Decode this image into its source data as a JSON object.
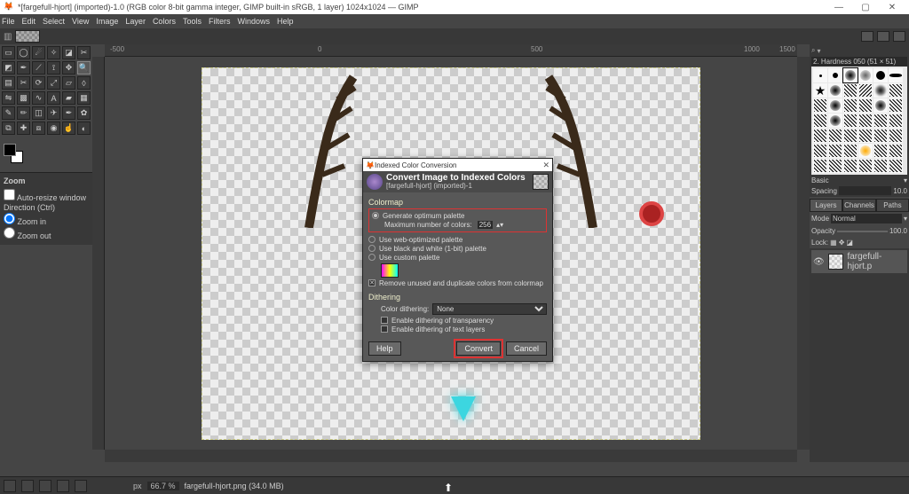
{
  "titlebar": {
    "text": "*[fargefull-hjort] (imported)-1.0 (RGB color 8-bit gamma integer, GIMP built-in sRGB, 1 layer) 1024x1024 — GIMP",
    "min": "—",
    "max": "▢",
    "close": "✕"
  },
  "menu": [
    "File",
    "Edit",
    "Select",
    "View",
    "Image",
    "Layer",
    "Colors",
    "Tools",
    "Filters",
    "Windows",
    "Help"
  ],
  "toolopts": {
    "heading": "Zoom",
    "auto": "Auto-resize window",
    "dir": "Direction  (Ctrl)",
    "zin": "Zoom in",
    "zout": "Zoom out"
  },
  "ruler_marks": [
    "-500",
    "0",
    "500",
    "1000",
    "1500"
  ],
  "brush": {
    "dropdown": "2. Hardness 050 (51 × 51)",
    "preset_label": "Basic",
    "spacing_label": "Spacing",
    "spacing_val": "10.0"
  },
  "right_tabs": [
    "Layers",
    "Channels",
    "Paths"
  ],
  "layers": {
    "mode_label": "Mode",
    "mode_val": "Normal",
    "opacity_label": "Opacity",
    "opacity_val": "100.0",
    "lock_label": "Lock:",
    "layer_name": "fargefull-hjort.p"
  },
  "status": {
    "px": "px",
    "zoom": "66.7 %",
    "file": "fargefull-hjort.png (34.0 MB)"
  },
  "dialog": {
    "wintitle": "Indexed Color Conversion",
    "title": "Convert Image to Indexed Colors",
    "subtitle": "[fargefull-hjort] (imported)-1",
    "sect1": "Colormap",
    "opt_gen": "Generate optimum palette",
    "max_label": "Maximum number of colors:",
    "max_val": "256",
    "opt_web": "Use web-optimized palette",
    "opt_bw": "Use black and white (1-bit) palette",
    "opt_custom": "Use custom palette",
    "chk_remove": "Remove unused and duplicate colors from colormap",
    "sect2": "Dithering",
    "dith_label": "Color dithering:",
    "dith_val": "None",
    "chk_trans": "Enable dithering of transparency",
    "chk_text": "Enable dithering of text layers",
    "btn_help": "Help",
    "btn_convert": "Convert",
    "btn_cancel": "Cancel"
  }
}
